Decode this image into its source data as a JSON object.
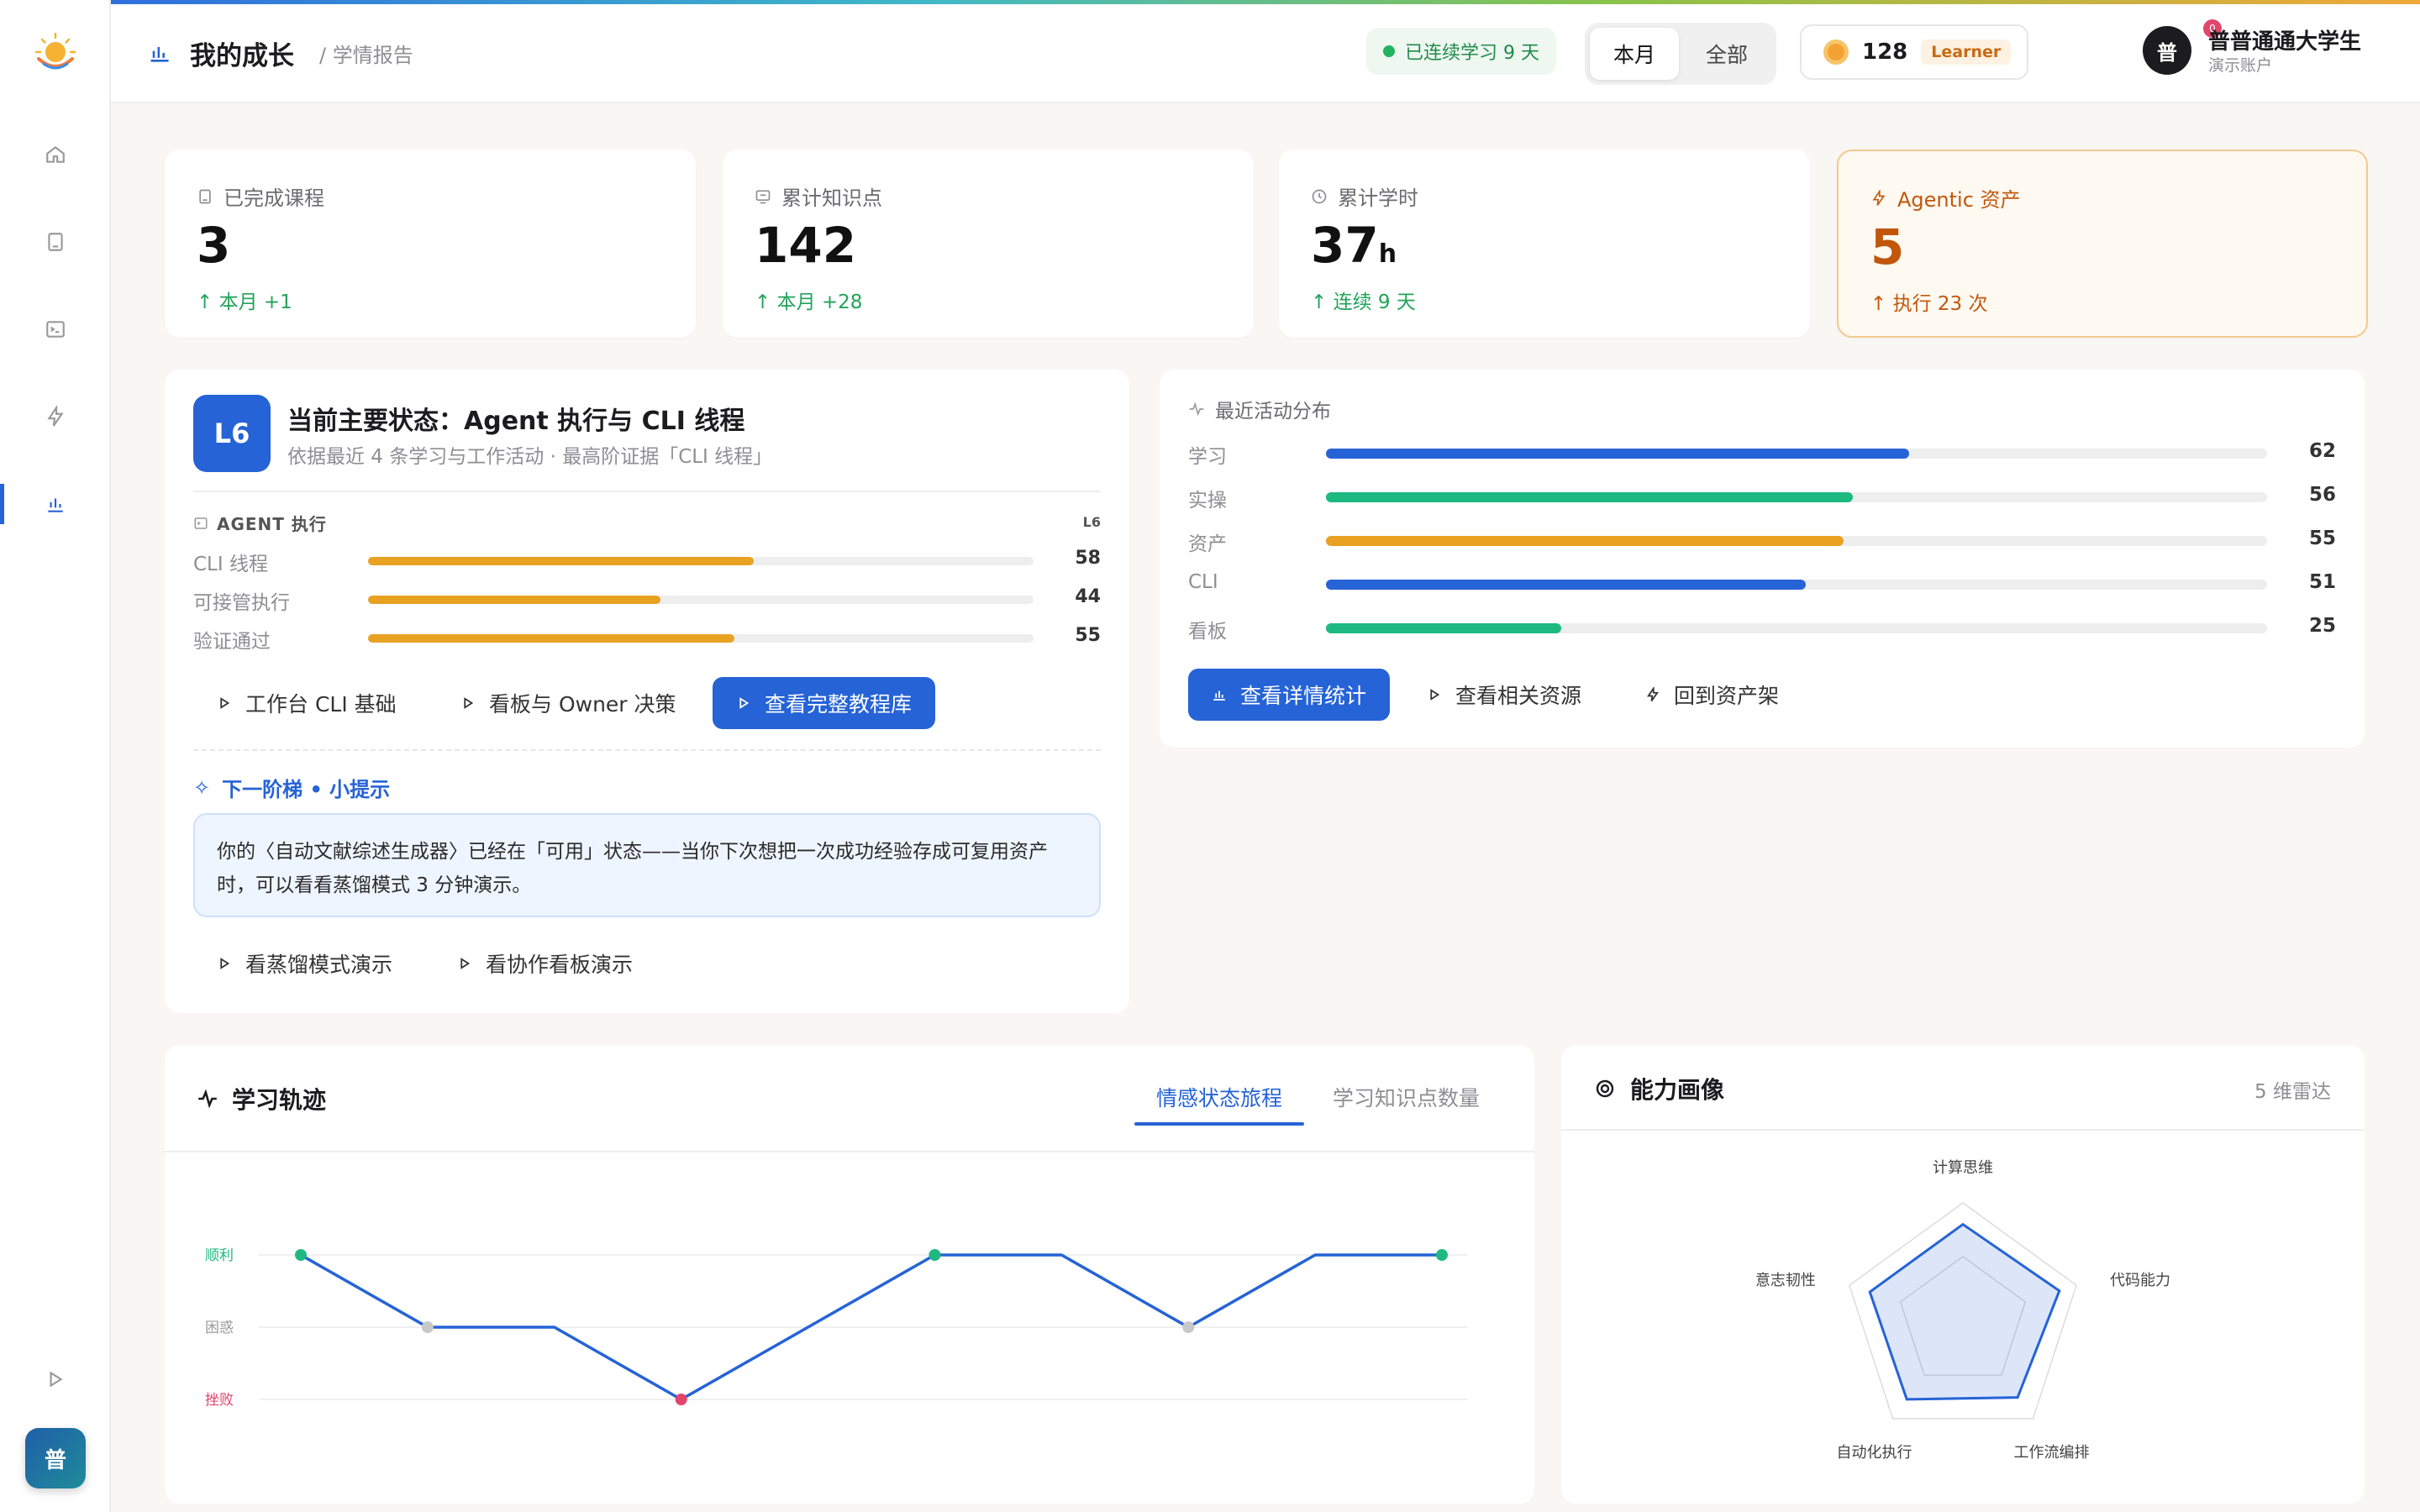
{
  "header": {
    "title": "我的成长",
    "breadcrumb": "/ 学情报告",
    "streak": "已连续学习 9 天",
    "period_tabs": [
      "本月",
      "全部"
    ],
    "coins": "128",
    "level": "Learner",
    "notification_count": "0",
    "user_initial": "普",
    "user_name": "普普通通大学生",
    "user_subtitle": "演示账户"
  },
  "sidebar": {
    "items": [
      "home-icon",
      "book-icon",
      "terminal-icon",
      "bolt-icon",
      "chart-icon",
      "play-icon"
    ],
    "active": "chart-icon",
    "avatar_initial": "普"
  },
  "stats": [
    {
      "label": "已完成课程",
      "value": "3",
      "unit": "",
      "delta": "本月 +1",
      "icon": "book-icon"
    },
    {
      "label": "累计知识点",
      "value": "142",
      "unit": "",
      "delta": "本月 +28",
      "icon": "monitor-icon"
    },
    {
      "label": "累计学时",
      "value": "37",
      "unit": "h",
      "delta": "连续 9 天",
      "icon": "clock-icon"
    },
    {
      "label": "Agentic 资产",
      "value": "5",
      "unit": "",
      "delta": "执行 23 次",
      "icon": "bolt-icon"
    }
  ],
  "state_card": {
    "badge": "L6",
    "title": "当前主要状态：Agent 执行与 CLI 线程",
    "subtitle": "依据最近 4 条学习与工作活动 · 最高阶证据「CLI 线程」",
    "section": "AGENT 执行",
    "section_level": "L6",
    "bars": [
      {
        "label": "CLI 线程",
        "value": 58
      },
      {
        "label": "可接管执行",
        "value": 44
      },
      {
        "label": "验证通过",
        "value": 55
      }
    ],
    "bar_color": "#e9a122",
    "buttons": [
      "工作台 CLI 基础",
      "看板与 Owner 决策",
      "查看完整教程库"
    ],
    "next_heading": "下一阶梯 • 小提示",
    "tip": "你的〈自动文献综述生成器〉已经在「可用」状态——当你下次想把一次成功经验存成可复用资产时，可以看看蒸馏模式 3 分钟演示。",
    "tip_buttons": [
      "看蒸馏模式演示",
      "看协作看板演示"
    ]
  },
  "activity": {
    "heading": "最近活动分布",
    "rows": [
      {
        "label": "学习",
        "value": 62,
        "color": "#2563d6"
      },
      {
        "label": "实操",
        "value": 56,
        "color": "#1db981"
      },
      {
        "label": "资产",
        "value": 55,
        "color": "#e9a122"
      },
      {
        "label": "CLI",
        "value": 51,
        "color": "#2563d6"
      },
      {
        "label": "看板",
        "value": 25,
        "color": "#1db981"
      }
    ],
    "buttons": [
      "查看详情统计",
      "查看相关资源",
      "回到资产架"
    ]
  },
  "trajectory": {
    "title": "学习轨迹",
    "tabs": [
      "情感状态旅程",
      "学习知识点数量"
    ],
    "active_tab": "情感状态旅程"
  },
  "radar": {
    "title": "能力画像",
    "subtitle": "5 维雷达"
  },
  "chart_data": [
    {
      "type": "line",
      "y_categories": [
        "挫败",
        "困惑",
        "顺利"
      ],
      "values": [
        "顺利",
        "困惑",
        "困惑",
        "挫败",
        "困惑",
        "顺利",
        "顺利",
        "困惑",
        "顺利",
        "顺利"
      ],
      "marker_colors": {
        "顺利": "#1db981",
        "困惑": "#c8c8c8",
        "挫败": "#e0466c"
      },
      "markers_at": [
        0,
        1,
        3,
        5,
        7,
        9
      ],
      "line_color": "#2563d6"
    },
    {
      "type": "radar",
      "axes": [
        "计算思维",
        "代码能力",
        "工作流编排",
        "自动化执行",
        "意志韧性"
      ],
      "values": [
        0.82,
        0.85,
        0.78,
        0.8,
        0.82
      ],
      "max": 1
    }
  ]
}
